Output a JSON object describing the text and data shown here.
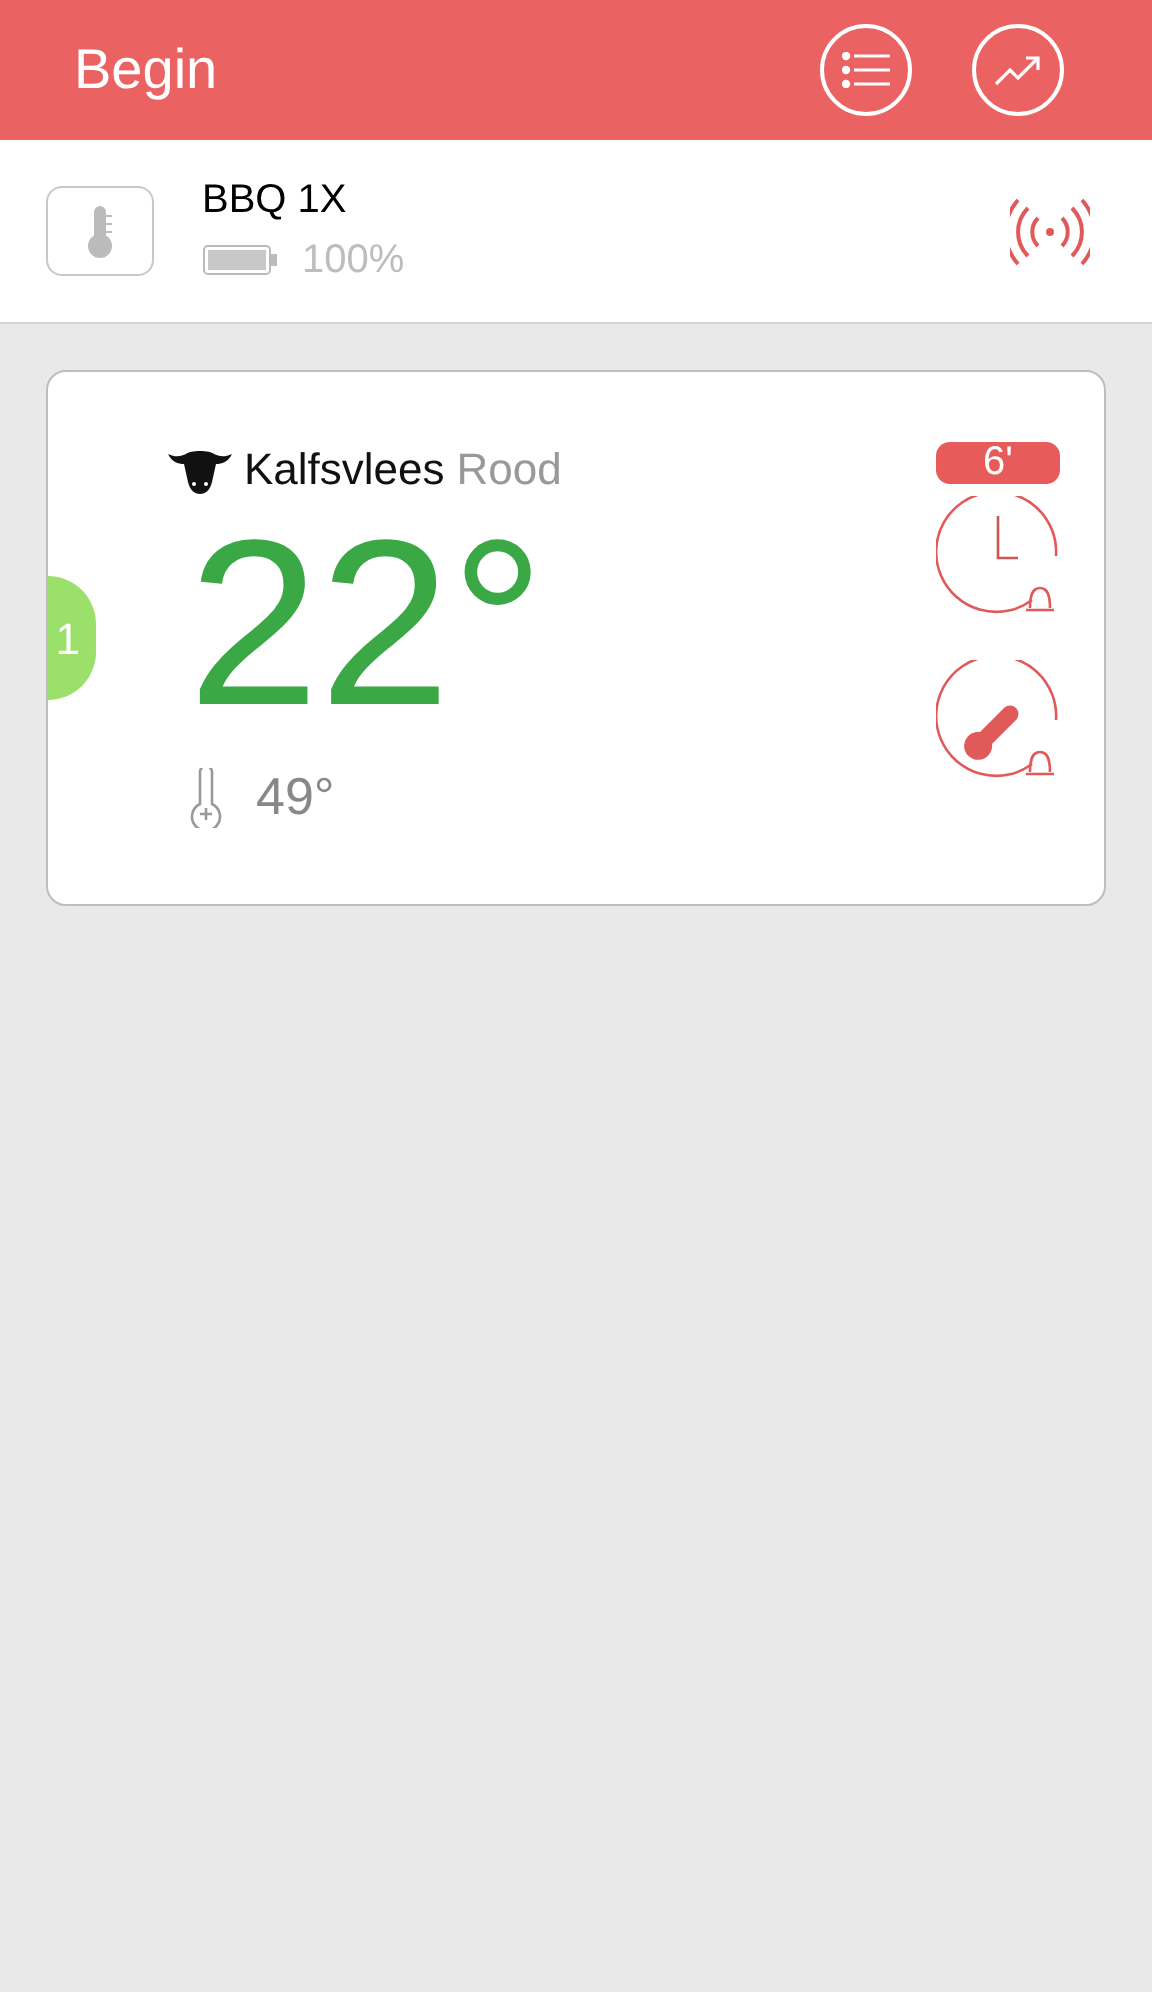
{
  "header": {
    "title": "Begin"
  },
  "device": {
    "name": "BBQ 1X",
    "battery": "100%"
  },
  "probes": [
    {
      "number": "1",
      "color": "#9be06a",
      "meat": "Kalfsvlees",
      "doneness": "Rood",
      "temperature": "22°",
      "target": "49°",
      "timer": "6'"
    }
  ]
}
